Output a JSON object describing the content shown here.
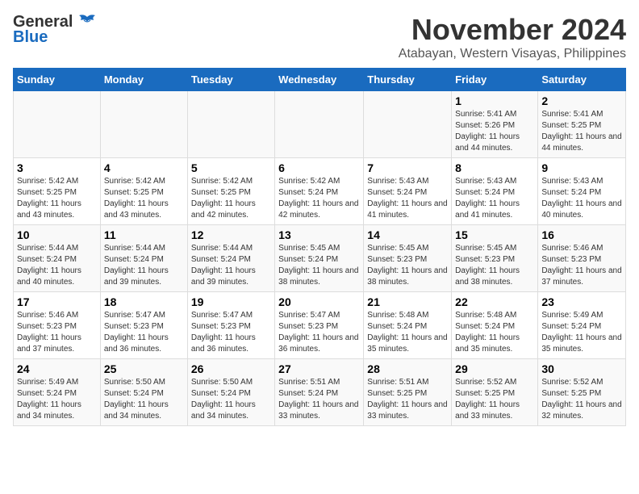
{
  "header": {
    "logo_general": "General",
    "logo_blue": "Blue",
    "month": "November 2024",
    "location": "Atabayan, Western Visayas, Philippines"
  },
  "weekdays": [
    "Sunday",
    "Monday",
    "Tuesday",
    "Wednesday",
    "Thursday",
    "Friday",
    "Saturday"
  ],
  "weeks": [
    [
      {
        "day": "",
        "info": ""
      },
      {
        "day": "",
        "info": ""
      },
      {
        "day": "",
        "info": ""
      },
      {
        "day": "",
        "info": ""
      },
      {
        "day": "",
        "info": ""
      },
      {
        "day": "1",
        "info": "Sunrise: 5:41 AM\nSunset: 5:26 PM\nDaylight: 11 hours and 44 minutes."
      },
      {
        "day": "2",
        "info": "Sunrise: 5:41 AM\nSunset: 5:25 PM\nDaylight: 11 hours and 44 minutes."
      }
    ],
    [
      {
        "day": "3",
        "info": "Sunrise: 5:42 AM\nSunset: 5:25 PM\nDaylight: 11 hours and 43 minutes."
      },
      {
        "day": "4",
        "info": "Sunrise: 5:42 AM\nSunset: 5:25 PM\nDaylight: 11 hours and 43 minutes."
      },
      {
        "day": "5",
        "info": "Sunrise: 5:42 AM\nSunset: 5:25 PM\nDaylight: 11 hours and 42 minutes."
      },
      {
        "day": "6",
        "info": "Sunrise: 5:42 AM\nSunset: 5:24 PM\nDaylight: 11 hours and 42 minutes."
      },
      {
        "day": "7",
        "info": "Sunrise: 5:43 AM\nSunset: 5:24 PM\nDaylight: 11 hours and 41 minutes."
      },
      {
        "day": "8",
        "info": "Sunrise: 5:43 AM\nSunset: 5:24 PM\nDaylight: 11 hours and 41 minutes."
      },
      {
        "day": "9",
        "info": "Sunrise: 5:43 AM\nSunset: 5:24 PM\nDaylight: 11 hours and 40 minutes."
      }
    ],
    [
      {
        "day": "10",
        "info": "Sunrise: 5:44 AM\nSunset: 5:24 PM\nDaylight: 11 hours and 40 minutes."
      },
      {
        "day": "11",
        "info": "Sunrise: 5:44 AM\nSunset: 5:24 PM\nDaylight: 11 hours and 39 minutes."
      },
      {
        "day": "12",
        "info": "Sunrise: 5:44 AM\nSunset: 5:24 PM\nDaylight: 11 hours and 39 minutes."
      },
      {
        "day": "13",
        "info": "Sunrise: 5:45 AM\nSunset: 5:24 PM\nDaylight: 11 hours and 38 minutes."
      },
      {
        "day": "14",
        "info": "Sunrise: 5:45 AM\nSunset: 5:23 PM\nDaylight: 11 hours and 38 minutes."
      },
      {
        "day": "15",
        "info": "Sunrise: 5:45 AM\nSunset: 5:23 PM\nDaylight: 11 hours and 38 minutes."
      },
      {
        "day": "16",
        "info": "Sunrise: 5:46 AM\nSunset: 5:23 PM\nDaylight: 11 hours and 37 minutes."
      }
    ],
    [
      {
        "day": "17",
        "info": "Sunrise: 5:46 AM\nSunset: 5:23 PM\nDaylight: 11 hours and 37 minutes."
      },
      {
        "day": "18",
        "info": "Sunrise: 5:47 AM\nSunset: 5:23 PM\nDaylight: 11 hours and 36 minutes."
      },
      {
        "day": "19",
        "info": "Sunrise: 5:47 AM\nSunset: 5:23 PM\nDaylight: 11 hours and 36 minutes."
      },
      {
        "day": "20",
        "info": "Sunrise: 5:47 AM\nSunset: 5:23 PM\nDaylight: 11 hours and 36 minutes."
      },
      {
        "day": "21",
        "info": "Sunrise: 5:48 AM\nSunset: 5:24 PM\nDaylight: 11 hours and 35 minutes."
      },
      {
        "day": "22",
        "info": "Sunrise: 5:48 AM\nSunset: 5:24 PM\nDaylight: 11 hours and 35 minutes."
      },
      {
        "day": "23",
        "info": "Sunrise: 5:49 AM\nSunset: 5:24 PM\nDaylight: 11 hours and 35 minutes."
      }
    ],
    [
      {
        "day": "24",
        "info": "Sunrise: 5:49 AM\nSunset: 5:24 PM\nDaylight: 11 hours and 34 minutes."
      },
      {
        "day": "25",
        "info": "Sunrise: 5:50 AM\nSunset: 5:24 PM\nDaylight: 11 hours and 34 minutes."
      },
      {
        "day": "26",
        "info": "Sunrise: 5:50 AM\nSunset: 5:24 PM\nDaylight: 11 hours and 34 minutes."
      },
      {
        "day": "27",
        "info": "Sunrise: 5:51 AM\nSunset: 5:24 PM\nDaylight: 11 hours and 33 minutes."
      },
      {
        "day": "28",
        "info": "Sunrise: 5:51 AM\nSunset: 5:25 PM\nDaylight: 11 hours and 33 minutes."
      },
      {
        "day": "29",
        "info": "Sunrise: 5:52 AM\nSunset: 5:25 PM\nDaylight: 11 hours and 33 minutes."
      },
      {
        "day": "30",
        "info": "Sunrise: 5:52 AM\nSunset: 5:25 PM\nDaylight: 11 hours and 32 minutes."
      }
    ]
  ]
}
